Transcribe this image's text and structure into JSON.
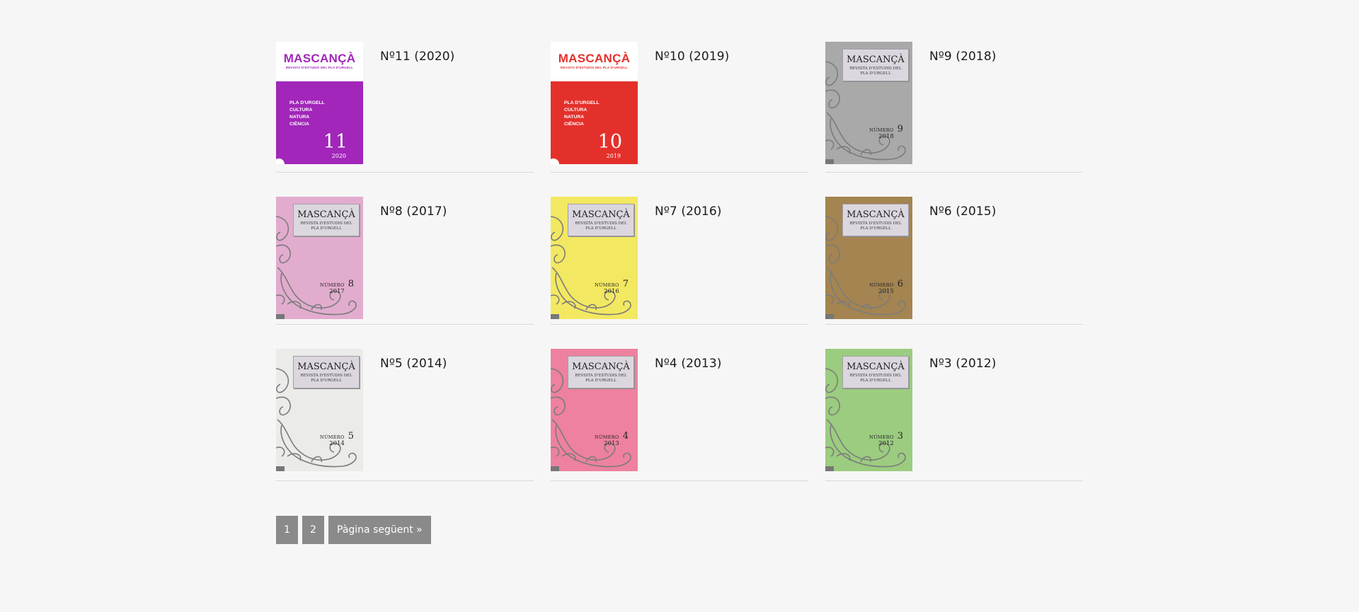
{
  "issues": [
    {
      "title": "Nº11 (2020)",
      "style": "new",
      "logo": "MASCANÇÀ",
      "logo_sub": "REVISTA D'ESTUDIS DEL PLA D'URGELL",
      "topics": [
        "PLA D'URGELL",
        "CULTURA",
        "NATURA",
        "CIÈNCIA"
      ],
      "number": "11",
      "year": "2020",
      "color": "#a126b9",
      "logo_color": "#a126b9"
    },
    {
      "title": "Nº10 (2019)",
      "style": "new",
      "logo": "MASCANÇÀ",
      "logo_sub": "REVISTA D'ESTUDIS DEL PLA D'URGELL",
      "topics": [
        "PLA D'URGELL",
        "CULTURA",
        "NATURA",
        "CIÈNCIA"
      ],
      "number": "10",
      "year": "2019",
      "color": "#e4302b",
      "logo_color": "#e4302b"
    },
    {
      "title": "Nº9 (2018)",
      "style": "classic",
      "logo": "MASCANÇÀ",
      "logo_sub": [
        "REVISTA D'ESTUDIS DEL",
        "PLA D'URGELL"
      ],
      "word": "NÚMERO",
      "number": "9",
      "year": "2018",
      "color": "#a9a9a9"
    },
    {
      "title": "Nº8 (2017)",
      "style": "classic",
      "logo": "MASCANÇÀ",
      "logo_sub": [
        "REVISTA D'ESTUDIS DEL",
        "PLA D'URGELL"
      ],
      "word": "NÚMERO",
      "number": "8",
      "year": "2017",
      "color": "#e2acce"
    },
    {
      "title": "Nº7 (2016)",
      "style": "classic",
      "logo": "MASCANÇÀ",
      "logo_sub": [
        "REVISTA D'ESTUDIS DEL",
        "PLA D'URGELL"
      ],
      "word": "NÚMERO",
      "number": "7",
      "year": "2016",
      "color": "#f3e861"
    },
    {
      "title": "Nº6 (2015)",
      "style": "classic",
      "logo": "MASCANÇÀ",
      "logo_sub": [
        "REVISTA D'ESTUDIS DEL",
        "PLA D'URGELL"
      ],
      "word": "NÚMERO",
      "number": "6",
      "year": "2015",
      "color": "#a48450"
    },
    {
      "title": "Nº5 (2014)",
      "style": "classic",
      "logo": "MASCANÇÀ",
      "logo_sub": [
        "REVISTA D'ESTUDIS DEL",
        "PLA D'URGELL"
      ],
      "word": "NÚMERO",
      "number": "5",
      "year": "2014",
      "color": "#ebebe9"
    },
    {
      "title": "Nº4 (2013)",
      "style": "classic",
      "logo": "MASCANÇÀ",
      "logo_sub": [
        "REVISTA D'ESTUDIS DEL",
        "PLA D'URGELL"
      ],
      "word": "NÚMERO",
      "number": "4",
      "year": "2013",
      "color": "#ee819f"
    },
    {
      "title": "Nº3 (2012)",
      "style": "classic",
      "logo": "MASCANÇÀ",
      "logo_sub": [
        "REVISTA D'ESTUDIS DEL",
        "PLA D'URGELL"
      ],
      "word": "NÚMERO",
      "number": "3",
      "year": "2012",
      "color": "#9bcc7f"
    }
  ],
  "pagination": {
    "pages": [
      "1",
      "2"
    ],
    "next_label": "Pàgina següent »"
  }
}
